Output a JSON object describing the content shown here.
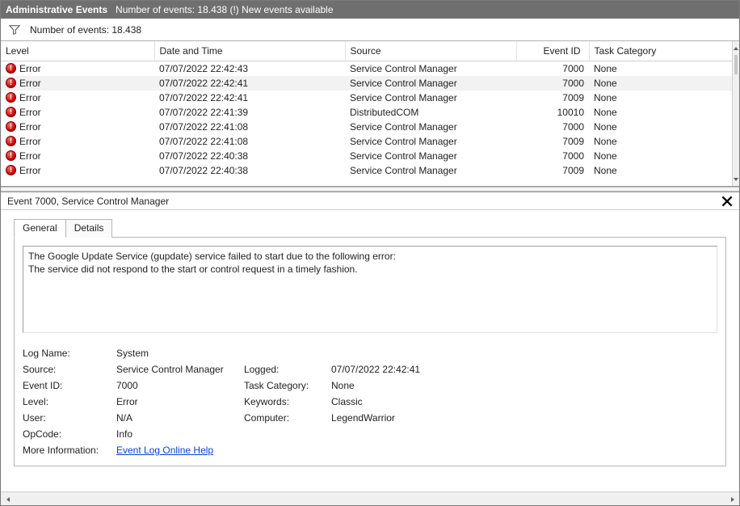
{
  "titlebar": {
    "title": "Administrative Events",
    "subtitle": "Number of events: 18.438 (!) New events available"
  },
  "filterbar": {
    "count_text": "Number of events: 18.438"
  },
  "columns": {
    "level": "Level",
    "date": "Date and Time",
    "source": "Source",
    "event_id": "Event ID",
    "task": "Task Category"
  },
  "events": [
    {
      "level": "Error",
      "icon": "error",
      "date": "07/07/2022 22:42:43",
      "source": "Service Control Manager",
      "event_id": "7000",
      "task": "None",
      "selected": false
    },
    {
      "level": "Error",
      "icon": "error",
      "date": "07/07/2022 22:42:41",
      "source": "Service Control Manager",
      "event_id": "7000",
      "task": "None",
      "selected": true
    },
    {
      "level": "Error",
      "icon": "error",
      "date": "07/07/2022 22:42:41",
      "source": "Service Control Manager",
      "event_id": "7009",
      "task": "None",
      "selected": false
    },
    {
      "level": "Error",
      "icon": "error",
      "date": "07/07/2022 22:41:39",
      "source": "DistributedCOM",
      "event_id": "10010",
      "task": "None",
      "selected": false
    },
    {
      "level": "Error",
      "icon": "error",
      "date": "07/07/2022 22:41:08",
      "source": "Service Control Manager",
      "event_id": "7000",
      "task": "None",
      "selected": false
    },
    {
      "level": "Error",
      "icon": "error",
      "date": "07/07/2022 22:41:08",
      "source": "Service Control Manager",
      "event_id": "7009",
      "task": "None",
      "selected": false
    },
    {
      "level": "Error",
      "icon": "error",
      "date": "07/07/2022 22:40:38",
      "source": "Service Control Manager",
      "event_id": "7000",
      "task": "None",
      "selected": false
    },
    {
      "level": "Error",
      "icon": "error",
      "date": "07/07/2022 22:40:38",
      "source": "Service Control Manager",
      "event_id": "7009",
      "task": "None",
      "selected": false
    }
  ],
  "detail": {
    "header": "Event 7000, Service Control Manager",
    "tabs": {
      "general": "General",
      "details": "Details"
    },
    "message_line1": "The Google Update Service (gupdate) service failed to start due to the following error:",
    "message_line2": "The service did not respond to the start or control request in a timely fashion.",
    "labels": {
      "log_name": "Log Name:",
      "source": "Source:",
      "event_id": "Event ID:",
      "level": "Level:",
      "user": "User:",
      "opcode": "OpCode:",
      "more_info": "More Information:",
      "logged": "Logged:",
      "task_category": "Task Category:",
      "keywords": "Keywords:",
      "computer": "Computer:"
    },
    "values": {
      "log_name": "System",
      "source": "Service Control Manager",
      "event_id": "7000",
      "level": "Error",
      "user": "N/A",
      "opcode": "Info",
      "more_info_link": "Event Log Online Help",
      "logged": "07/07/2022 22:42:41",
      "task_category": "None",
      "keywords": "Classic",
      "computer": "LegendWarrior"
    }
  }
}
